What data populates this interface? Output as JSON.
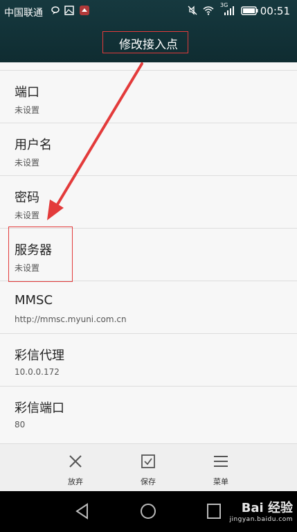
{
  "status_bar": {
    "carrier": "中国联通",
    "time": "00:51",
    "network": "3G",
    "icons": [
      "chat-bubble-icon",
      "image-icon",
      "app-notification-icon",
      "mute-icon",
      "wifi-icon",
      "signal-icon",
      "battery-icon"
    ]
  },
  "header": {
    "title": "修改接入点"
  },
  "settings": [
    {
      "label": "端口",
      "value": "未设置"
    },
    {
      "label": "用户名",
      "value": "未设置"
    },
    {
      "label": "密码",
      "value": "未设置"
    },
    {
      "label": "服务器",
      "value": "未设置"
    },
    {
      "label": "MMSC",
      "value": "http://mmsc.myuni.com.cn"
    },
    {
      "label": "彩信代理",
      "value": "10.0.0.172"
    },
    {
      "label": "彩信端口",
      "value": "80"
    }
  ],
  "toolbar": {
    "discard_label": "放弃",
    "save_label": "保存",
    "menu_label": "菜单"
  },
  "watermark": {
    "brand": "Bai 经验",
    "url": "jingyan.baidu.com"
  },
  "colors": {
    "header_bg": "#12343a",
    "annotation_red": "#e33b3b",
    "list_bg": "#f7f7f7"
  }
}
